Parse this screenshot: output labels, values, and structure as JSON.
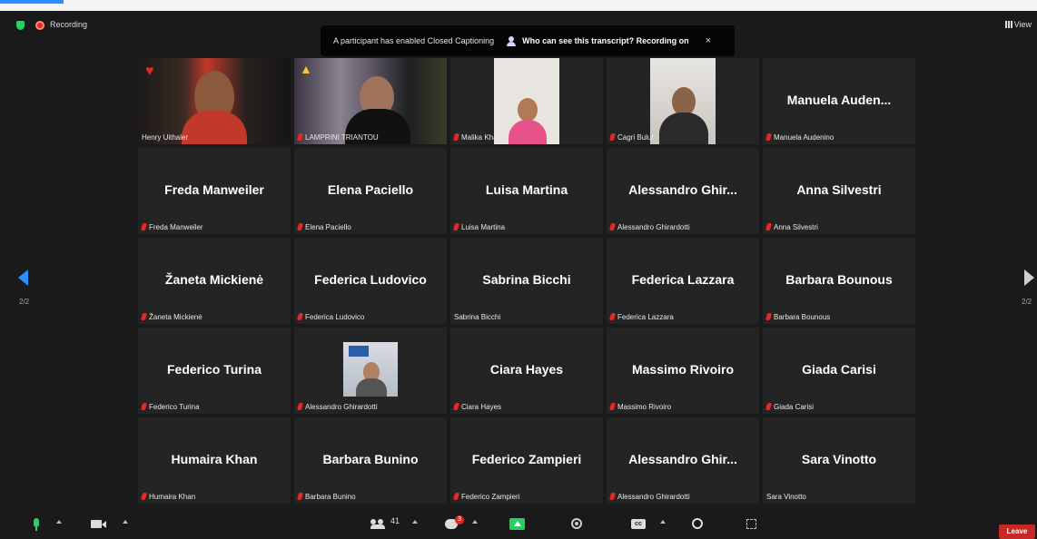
{
  "topbar": {
    "recording_label": "Recording",
    "view_label": "View"
  },
  "notification": {
    "message": "A participant has enabled Closed Captioning",
    "link_text": "Who can see this transcript? Recording on",
    "close_glyph": "×"
  },
  "tiles": [
    {
      "display": "",
      "label": "Henry Uithaler"
    },
    {
      "display": "",
      "label": "LAMPRINI TRIANTOU"
    },
    {
      "display": "",
      "label": "Malika Khan"
    },
    {
      "display": "",
      "label": "Cagri Bulut"
    },
    {
      "display": "Manuela  Auden...",
      "label": "Manuela Audenino"
    },
    {
      "display": "Freda Manweiler",
      "label": "Freda Manweiler"
    },
    {
      "display": "Elena Paciello",
      "label": "Elena Paciello"
    },
    {
      "display": "Luisa Martina",
      "label": "Luisa Martina"
    },
    {
      "display": "Alessandro  Ghir...",
      "label": "Alessandro Ghirardotti"
    },
    {
      "display": "Anna Silvestri",
      "label": "Anna Silvestri"
    },
    {
      "display": "Žaneta Mickienė",
      "label": "Žaneta Mickienė"
    },
    {
      "display": "Federica Ludovico",
      "label": "Federica Ludovico"
    },
    {
      "display": "Sabrina Bicchi",
      "label": "Sabrina Bicchi"
    },
    {
      "display": "Federica Lazzara",
      "label": "Federica Lazzara"
    },
    {
      "display": "Barbara Bounous",
      "label": "Barbara Bounous"
    },
    {
      "display": "Federico Turina",
      "label": "Federico Turina"
    },
    {
      "display": "",
      "label": "Alessandro Ghirardotti"
    },
    {
      "display": "Ciara Hayes",
      "label": "Ciara Hayes"
    },
    {
      "display": "Massimo Rivoiro",
      "label": "Massimo Rivoiro"
    },
    {
      "display": "Giada Carisi",
      "label": "Giada Carisi"
    },
    {
      "display": "Humaira Khan",
      "label": "Humaira Khan"
    },
    {
      "display": "Barbara Bunino",
      "label": "Barbara Bunino"
    },
    {
      "display": "Federico Zampieri",
      "label": "Federico Zampieri"
    },
    {
      "display": "Alessandro  Ghir...",
      "label": "Alessandro Ghirardotti"
    },
    {
      "display": "Sara Vinotto",
      "label": "Sara Vinotto"
    }
  ],
  "pagination": {
    "left_label": "2/2",
    "right_label": "2/2"
  },
  "toolbar": {
    "participants_count": "41",
    "chat_badge": "3",
    "cc_label": "cc",
    "leave_label": "Leave"
  }
}
